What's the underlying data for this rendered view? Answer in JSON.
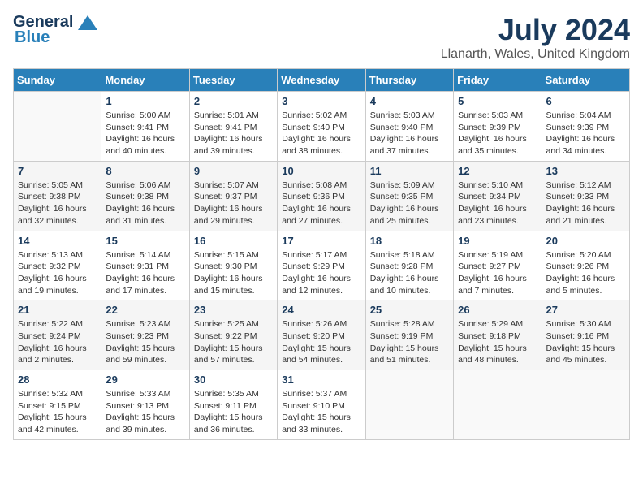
{
  "logo": {
    "general": "General",
    "blue": "Blue"
  },
  "header": {
    "month_year": "July 2024",
    "location": "Llanarth, Wales, United Kingdom"
  },
  "weekdays": [
    "Sunday",
    "Monday",
    "Tuesday",
    "Wednesday",
    "Thursday",
    "Friday",
    "Saturday"
  ],
  "weeks": [
    [
      {
        "day": "",
        "sunrise": "",
        "sunset": "",
        "daylight": ""
      },
      {
        "day": "1",
        "sunrise": "Sunrise: 5:00 AM",
        "sunset": "Sunset: 9:41 PM",
        "daylight": "Daylight: 16 hours and 40 minutes."
      },
      {
        "day": "2",
        "sunrise": "Sunrise: 5:01 AM",
        "sunset": "Sunset: 9:41 PM",
        "daylight": "Daylight: 16 hours and 39 minutes."
      },
      {
        "day": "3",
        "sunrise": "Sunrise: 5:02 AM",
        "sunset": "Sunset: 9:40 PM",
        "daylight": "Daylight: 16 hours and 38 minutes."
      },
      {
        "day": "4",
        "sunrise": "Sunrise: 5:03 AM",
        "sunset": "Sunset: 9:40 PM",
        "daylight": "Daylight: 16 hours and 37 minutes."
      },
      {
        "day": "5",
        "sunrise": "Sunrise: 5:03 AM",
        "sunset": "Sunset: 9:39 PM",
        "daylight": "Daylight: 16 hours and 35 minutes."
      },
      {
        "day": "6",
        "sunrise": "Sunrise: 5:04 AM",
        "sunset": "Sunset: 9:39 PM",
        "daylight": "Daylight: 16 hours and 34 minutes."
      }
    ],
    [
      {
        "day": "7",
        "sunrise": "Sunrise: 5:05 AM",
        "sunset": "Sunset: 9:38 PM",
        "daylight": "Daylight: 16 hours and 32 minutes."
      },
      {
        "day": "8",
        "sunrise": "Sunrise: 5:06 AM",
        "sunset": "Sunset: 9:38 PM",
        "daylight": "Daylight: 16 hours and 31 minutes."
      },
      {
        "day": "9",
        "sunrise": "Sunrise: 5:07 AM",
        "sunset": "Sunset: 9:37 PM",
        "daylight": "Daylight: 16 hours and 29 minutes."
      },
      {
        "day": "10",
        "sunrise": "Sunrise: 5:08 AM",
        "sunset": "Sunset: 9:36 PM",
        "daylight": "Daylight: 16 hours and 27 minutes."
      },
      {
        "day": "11",
        "sunrise": "Sunrise: 5:09 AM",
        "sunset": "Sunset: 9:35 PM",
        "daylight": "Daylight: 16 hours and 25 minutes."
      },
      {
        "day": "12",
        "sunrise": "Sunrise: 5:10 AM",
        "sunset": "Sunset: 9:34 PM",
        "daylight": "Daylight: 16 hours and 23 minutes."
      },
      {
        "day": "13",
        "sunrise": "Sunrise: 5:12 AM",
        "sunset": "Sunset: 9:33 PM",
        "daylight": "Daylight: 16 hours and 21 minutes."
      }
    ],
    [
      {
        "day": "14",
        "sunrise": "Sunrise: 5:13 AM",
        "sunset": "Sunset: 9:32 PM",
        "daylight": "Daylight: 16 hours and 19 minutes."
      },
      {
        "day": "15",
        "sunrise": "Sunrise: 5:14 AM",
        "sunset": "Sunset: 9:31 PM",
        "daylight": "Daylight: 16 hours and 17 minutes."
      },
      {
        "day": "16",
        "sunrise": "Sunrise: 5:15 AM",
        "sunset": "Sunset: 9:30 PM",
        "daylight": "Daylight: 16 hours and 15 minutes."
      },
      {
        "day": "17",
        "sunrise": "Sunrise: 5:17 AM",
        "sunset": "Sunset: 9:29 PM",
        "daylight": "Daylight: 16 hours and 12 minutes."
      },
      {
        "day": "18",
        "sunrise": "Sunrise: 5:18 AM",
        "sunset": "Sunset: 9:28 PM",
        "daylight": "Daylight: 16 hours and 10 minutes."
      },
      {
        "day": "19",
        "sunrise": "Sunrise: 5:19 AM",
        "sunset": "Sunset: 9:27 PM",
        "daylight": "Daylight: 16 hours and 7 minutes."
      },
      {
        "day": "20",
        "sunrise": "Sunrise: 5:20 AM",
        "sunset": "Sunset: 9:26 PM",
        "daylight": "Daylight: 16 hours and 5 minutes."
      }
    ],
    [
      {
        "day": "21",
        "sunrise": "Sunrise: 5:22 AM",
        "sunset": "Sunset: 9:24 PM",
        "daylight": "Daylight: 16 hours and 2 minutes."
      },
      {
        "day": "22",
        "sunrise": "Sunrise: 5:23 AM",
        "sunset": "Sunset: 9:23 PM",
        "daylight": "Daylight: 15 hours and 59 minutes."
      },
      {
        "day": "23",
        "sunrise": "Sunrise: 5:25 AM",
        "sunset": "Sunset: 9:22 PM",
        "daylight": "Daylight: 15 hours and 57 minutes."
      },
      {
        "day": "24",
        "sunrise": "Sunrise: 5:26 AM",
        "sunset": "Sunset: 9:20 PM",
        "daylight": "Daylight: 15 hours and 54 minutes."
      },
      {
        "day": "25",
        "sunrise": "Sunrise: 5:28 AM",
        "sunset": "Sunset: 9:19 PM",
        "daylight": "Daylight: 15 hours and 51 minutes."
      },
      {
        "day": "26",
        "sunrise": "Sunrise: 5:29 AM",
        "sunset": "Sunset: 9:18 PM",
        "daylight": "Daylight: 15 hours and 48 minutes."
      },
      {
        "day": "27",
        "sunrise": "Sunrise: 5:30 AM",
        "sunset": "Sunset: 9:16 PM",
        "daylight": "Daylight: 15 hours and 45 minutes."
      }
    ],
    [
      {
        "day": "28",
        "sunrise": "Sunrise: 5:32 AM",
        "sunset": "Sunset: 9:15 PM",
        "daylight": "Daylight: 15 hours and 42 minutes."
      },
      {
        "day": "29",
        "sunrise": "Sunrise: 5:33 AM",
        "sunset": "Sunset: 9:13 PM",
        "daylight": "Daylight: 15 hours and 39 minutes."
      },
      {
        "day": "30",
        "sunrise": "Sunrise: 5:35 AM",
        "sunset": "Sunset: 9:11 PM",
        "daylight": "Daylight: 15 hours and 36 minutes."
      },
      {
        "day": "31",
        "sunrise": "Sunrise: 5:37 AM",
        "sunset": "Sunset: 9:10 PM",
        "daylight": "Daylight: 15 hours and 33 minutes."
      },
      {
        "day": "",
        "sunrise": "",
        "sunset": "",
        "daylight": ""
      },
      {
        "day": "",
        "sunrise": "",
        "sunset": "",
        "daylight": ""
      },
      {
        "day": "",
        "sunrise": "",
        "sunset": "",
        "daylight": ""
      }
    ]
  ]
}
